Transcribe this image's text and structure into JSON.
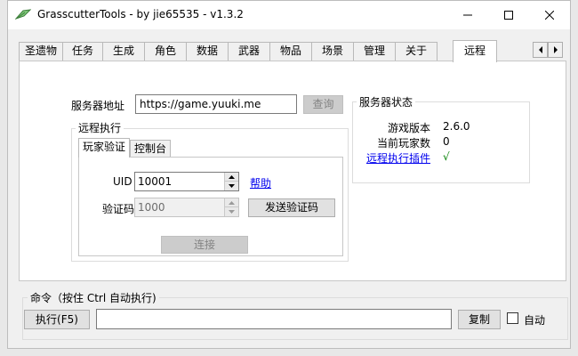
{
  "window": {
    "title": "GrasscutterTools  - by jie65535  - v1.3.2"
  },
  "tabs": [
    {
      "label": "圣遗物",
      "active": false
    },
    {
      "label": "任务",
      "active": false
    },
    {
      "label": "生成",
      "active": false
    },
    {
      "label": "角色",
      "active": false
    },
    {
      "label": "数据",
      "active": false
    },
    {
      "label": "武器",
      "active": false
    },
    {
      "label": "物品",
      "active": false
    },
    {
      "label": "场景",
      "active": false
    },
    {
      "label": "管理",
      "active": false
    },
    {
      "label": "关于",
      "active": false
    },
    {
      "label": "远程",
      "active": true
    }
  ],
  "remote": {
    "server_address_label": "服务器地址",
    "server_address_value": "https://game.yuuki.me",
    "query_button": "查询",
    "remote_exec_title": "远程执行",
    "inner_tabs": [
      {
        "label": "玩家验证",
        "active": true
      },
      {
        "label": "控制台",
        "active": false
      }
    ],
    "uid_label": "UID",
    "uid_value": "10001",
    "help_link": "帮助",
    "code_label": "验证码",
    "code_value": "1000",
    "send_code_button": "发送验证码",
    "connect_button": "连接",
    "server_status": {
      "title": "服务器状态",
      "game_version_label": "游戏版本",
      "game_version_value": "2.6.0",
      "online_players_label": "当前玩家数",
      "online_players_value": "0",
      "plugin_link": "远程执行插件",
      "plugin_status": "√"
    }
  },
  "command": {
    "title": "命令（按住 Ctrl 自动执行)",
    "execute_button": "执行(F5)",
    "input_value": "",
    "copy_button": "复制",
    "auto_label": "自动"
  },
  "colors": {
    "link": "#0000ee",
    "check": "#008000",
    "window_bg": "#f0f0f0"
  }
}
